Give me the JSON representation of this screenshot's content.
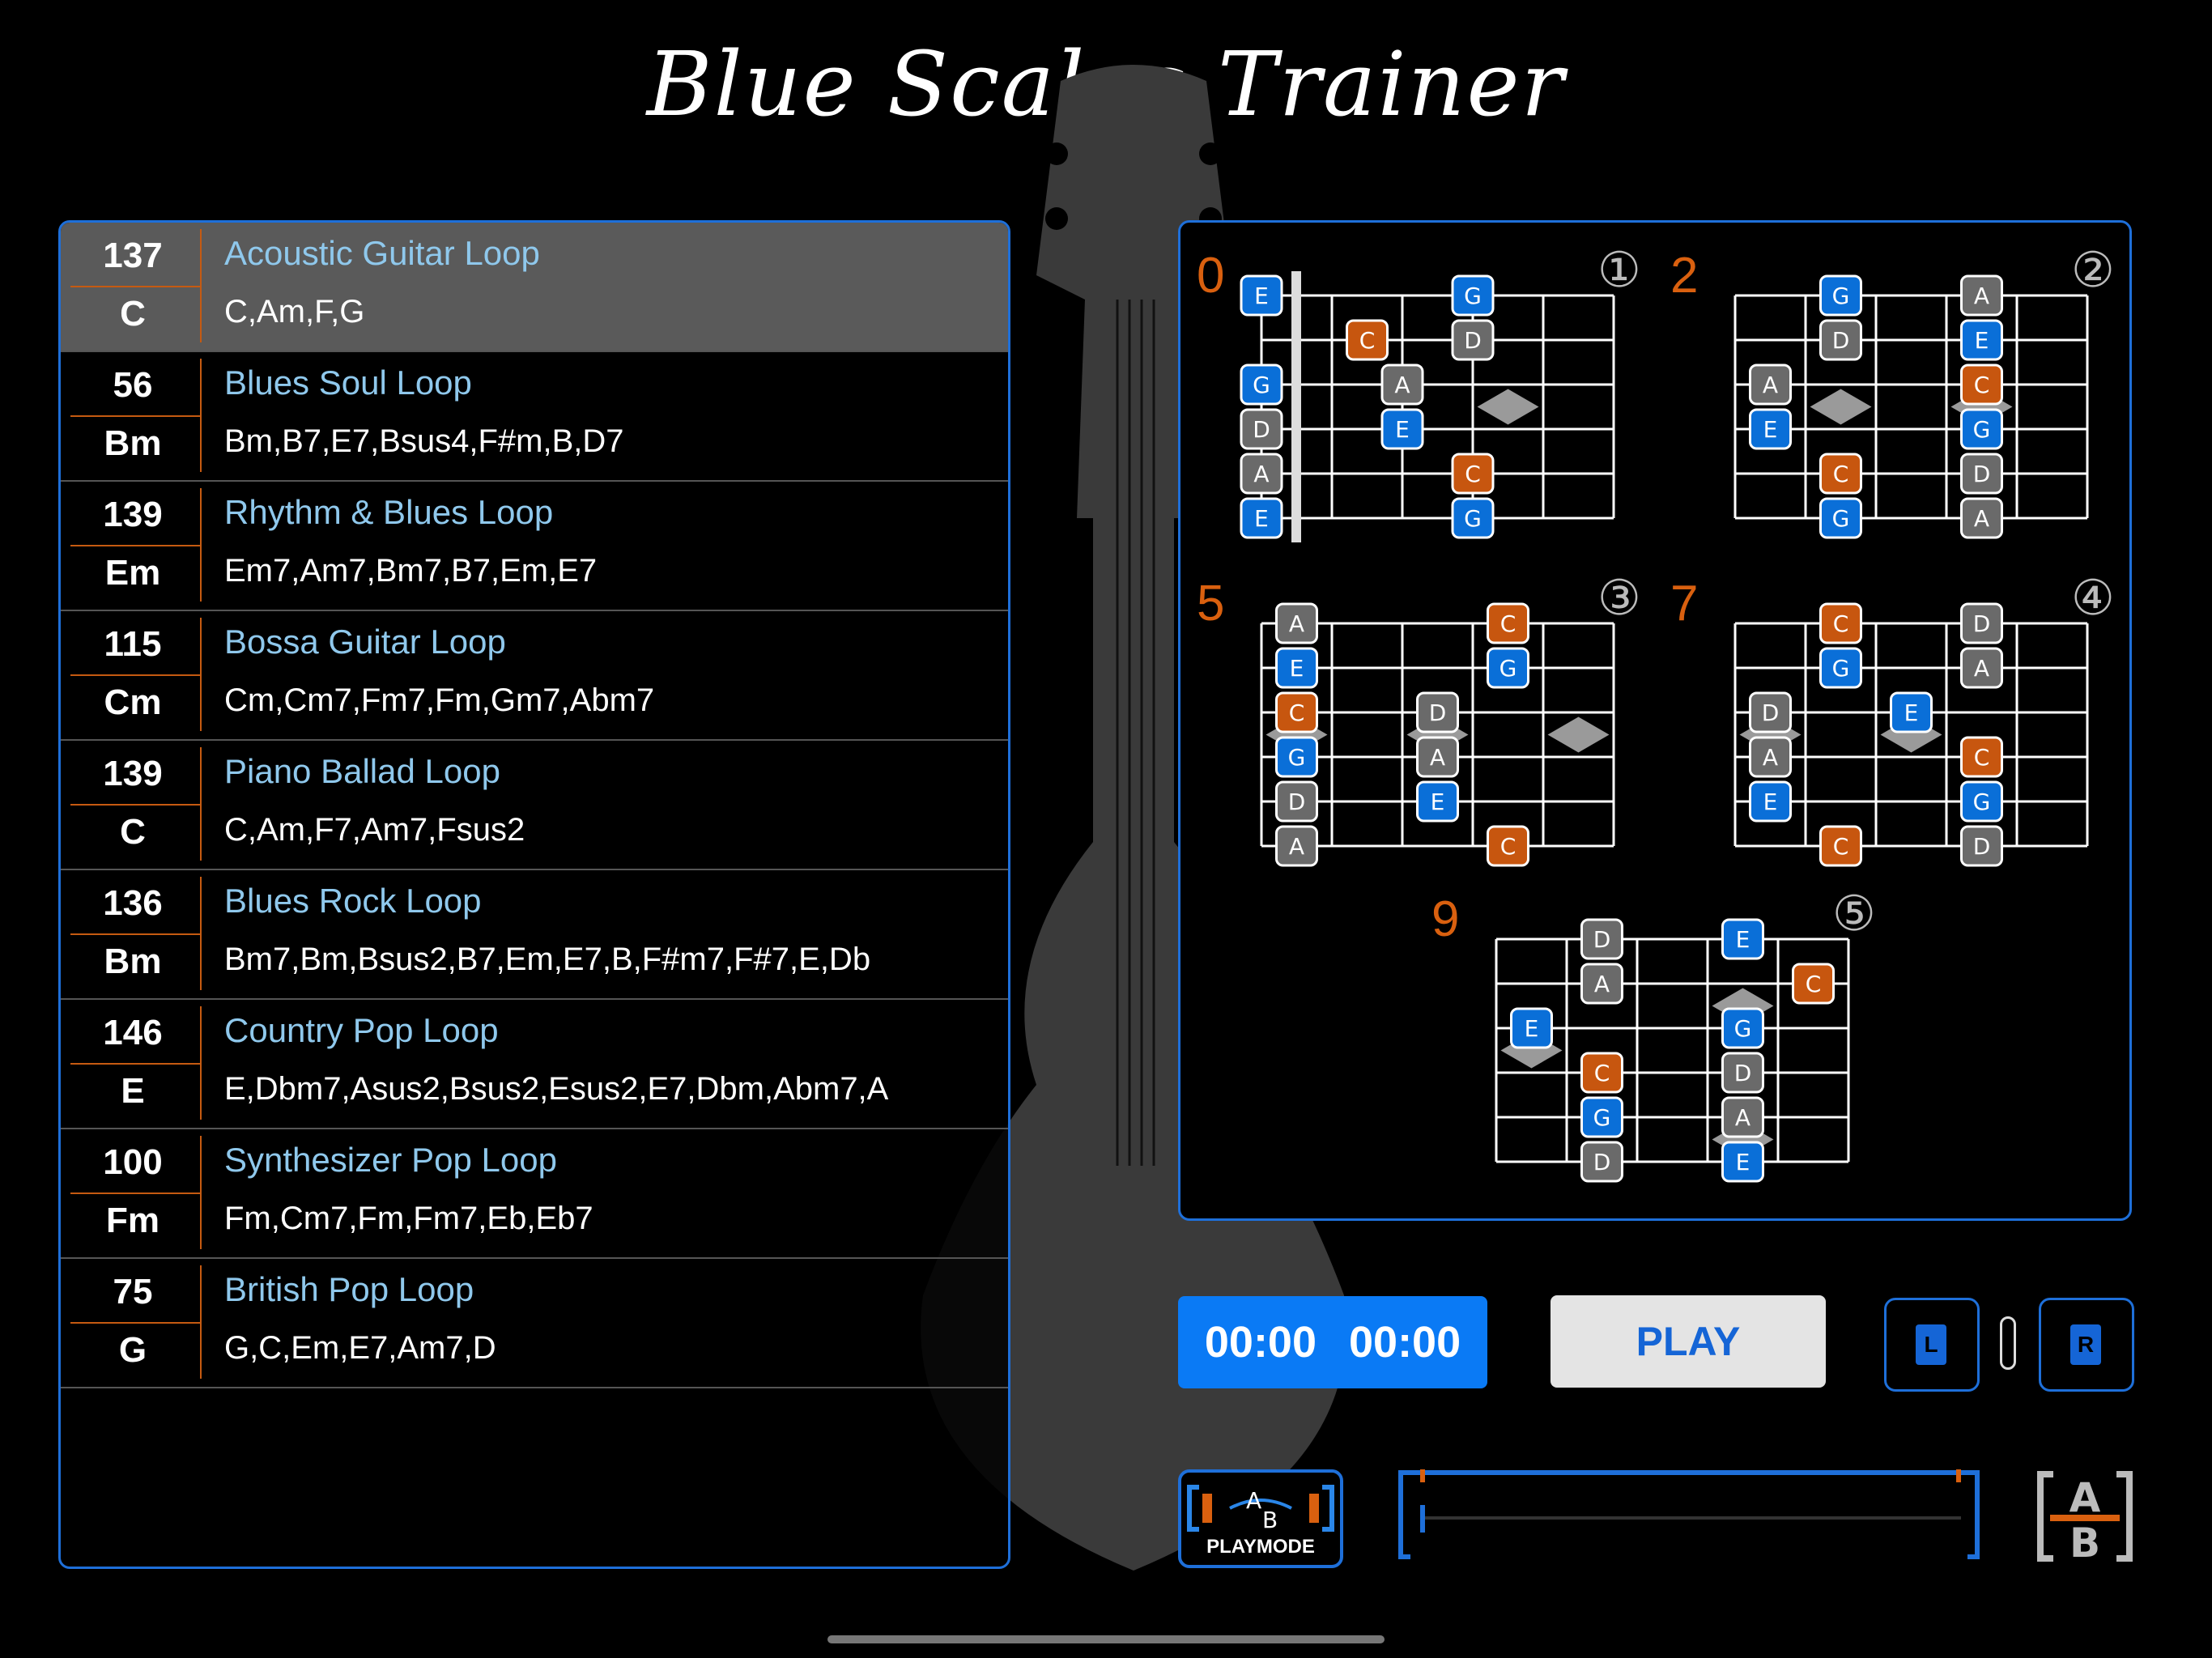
{
  "app": {
    "title": "Blue Scales Trainer"
  },
  "loops": [
    {
      "bpm": "137",
      "key": "C",
      "name": "Acoustic Guitar Loop",
      "chords": "C,Am,F,G",
      "selected": true
    },
    {
      "bpm": "56",
      "key": "Bm",
      "name": "Blues Soul Loop",
      "chords": "Bm,B7,E7,Bsus4,F#m,B,D7"
    },
    {
      "bpm": "139",
      "key": "Em",
      "name": "Rhythm & Blues Loop",
      "chords": "Em7,Am7,Bm7,B7,Em,E7"
    },
    {
      "bpm": "115",
      "key": "Cm",
      "name": "Bossa Guitar Loop",
      "chords": "Cm,Cm7,Fm7,Fm,Gm7,Abm7"
    },
    {
      "bpm": "139",
      "key": "C",
      "name": "Piano Ballad Loop",
      "chords": "C,Am,F7,Am7,Fsus2"
    },
    {
      "bpm": "136",
      "key": "Bm",
      "name": "Blues Rock Loop",
      "chords": "Bm7,Bm,Bsus2,B7,Em,E7,B,F#m7,F#7,E,Db"
    },
    {
      "bpm": "146",
      "key": "E",
      "name": "Country Pop Loop",
      "chords": "E,Dbm7,Asus2,Bsus2,Esus2,E7,Dbm,Abm7,A"
    },
    {
      "bpm": "100",
      "key": "Fm",
      "name": "Synthesizer Pop Loop",
      "chords": "Fm,Cm7,Fm,Fm7,Eb,Eb7"
    },
    {
      "bpm": "75",
      "key": "G",
      "name": "British Pop Loop",
      "chords": "G,C,Em,E7,Am7,D"
    }
  ],
  "scale_diagrams": [
    {
      "fret": "0",
      "position": "①",
      "nut": true,
      "notes": [
        {
          "s": 0,
          "f": 0,
          "n": "E",
          "c": "blue"
        },
        {
          "s": 0,
          "f": 3,
          "n": "G",
          "c": "blue"
        },
        {
          "s": 1,
          "f": 1.5,
          "n": "C",
          "c": "orange"
        },
        {
          "s": 1,
          "f": 3,
          "n": "D",
          "c": "gray"
        },
        {
          "s": 2,
          "f": 0,
          "n": "G",
          "c": "blue"
        },
        {
          "s": 2,
          "f": 2,
          "n": "A",
          "c": "gray"
        },
        {
          "s": 3,
          "f": 0,
          "n": "D",
          "c": "gray"
        },
        {
          "s": 3,
          "f": 2,
          "n": "E",
          "c": "blue"
        },
        {
          "s": 4,
          "f": 0,
          "n": "A",
          "c": "gray"
        },
        {
          "s": 4,
          "f": 3,
          "n": "C",
          "c": "orange"
        },
        {
          "s": 5,
          "f": 0,
          "n": "E",
          "c": "blue"
        },
        {
          "s": 5,
          "f": 3,
          "n": "G",
          "c": "blue"
        }
      ],
      "markers": [
        {
          "f": 3.5,
          "s": 2.5
        }
      ]
    },
    {
      "fret": "2",
      "position": "②",
      "notes": [
        {
          "s": 0,
          "f": 1.5,
          "n": "G",
          "c": "blue"
        },
        {
          "s": 0,
          "f": 3.5,
          "n": "A",
          "c": "gray"
        },
        {
          "s": 1,
          "f": 1.5,
          "n": "D",
          "c": "gray"
        },
        {
          "s": 1,
          "f": 3.5,
          "n": "E",
          "c": "blue"
        },
        {
          "s": 2,
          "f": 0.5,
          "n": "A",
          "c": "gray"
        },
        {
          "s": 2,
          "f": 3.5,
          "n": "C",
          "c": "orange"
        },
        {
          "s": 3,
          "f": 0.5,
          "n": "E",
          "c": "blue"
        },
        {
          "s": 3,
          "f": 3.5,
          "n": "G",
          "c": "blue"
        },
        {
          "s": 4,
          "f": 1.5,
          "n": "C",
          "c": "orange"
        },
        {
          "s": 4,
          "f": 3.5,
          "n": "D",
          "c": "gray"
        },
        {
          "s": 5,
          "f": 1.5,
          "n": "G",
          "c": "blue"
        },
        {
          "s": 5,
          "f": 3.5,
          "n": "A",
          "c": "gray"
        }
      ],
      "markers": [
        {
          "f": 1.5,
          "s": 2.5
        },
        {
          "f": 3.5,
          "s": 2.5
        }
      ]
    },
    {
      "fret": "5",
      "position": "③",
      "notes": [
        {
          "s": 0,
          "f": 0.5,
          "n": "A",
          "c": "gray"
        },
        {
          "s": 0,
          "f": 3.5,
          "n": "C",
          "c": "orange"
        },
        {
          "s": 1,
          "f": 0.5,
          "n": "E",
          "c": "blue"
        },
        {
          "s": 1,
          "f": 3.5,
          "n": "G",
          "c": "blue"
        },
        {
          "s": 2,
          "f": 0.5,
          "n": "C",
          "c": "orange"
        },
        {
          "s": 2,
          "f": 2.5,
          "n": "D",
          "c": "gray"
        },
        {
          "s": 3,
          "f": 0.5,
          "n": "G",
          "c": "blue"
        },
        {
          "s": 3,
          "f": 2.5,
          "n": "A",
          "c": "gray"
        },
        {
          "s": 4,
          "f": 0.5,
          "n": "D",
          "c": "gray"
        },
        {
          "s": 4,
          "f": 2.5,
          "n": "E",
          "c": "blue"
        },
        {
          "s": 5,
          "f": 0.5,
          "n": "A",
          "c": "gray"
        },
        {
          "s": 5,
          "f": 3.5,
          "n": "C",
          "c": "orange"
        }
      ],
      "markers": [
        {
          "f": 0.5,
          "s": 2.5
        },
        {
          "f": 2.5,
          "s": 2.5
        },
        {
          "f": 4.5,
          "s": 2.5
        }
      ]
    },
    {
      "fret": "7",
      "position": "④",
      "notes": [
        {
          "s": 0,
          "f": 1.5,
          "n": "C",
          "c": "orange"
        },
        {
          "s": 0,
          "f": 3.5,
          "n": "D",
          "c": "gray"
        },
        {
          "s": 1,
          "f": 1.5,
          "n": "G",
          "c": "blue"
        },
        {
          "s": 1,
          "f": 3.5,
          "n": "A",
          "c": "gray"
        },
        {
          "s": 2,
          "f": 0.5,
          "n": "D",
          "c": "gray"
        },
        {
          "s": 2,
          "f": 2.5,
          "n": "E",
          "c": "blue"
        },
        {
          "s": 3,
          "f": 0.5,
          "n": "A",
          "c": "gray"
        },
        {
          "s": 3,
          "f": 3.5,
          "n": "C",
          "c": "orange"
        },
        {
          "s": 4,
          "f": 0.5,
          "n": "E",
          "c": "blue"
        },
        {
          "s": 4,
          "f": 3.5,
          "n": "G",
          "c": "blue"
        },
        {
          "s": 5,
          "f": 1.5,
          "n": "C",
          "c": "orange"
        },
        {
          "s": 5,
          "f": 3.5,
          "n": "D",
          "c": "gray"
        }
      ],
      "markers": [
        {
          "f": 0.5,
          "s": 2.5
        },
        {
          "f": 2.5,
          "s": 2.5
        }
      ]
    },
    {
      "fret": "9",
      "position": "⑤",
      "notes": [
        {
          "s": 0,
          "f": 1.5,
          "n": "D",
          "c": "gray"
        },
        {
          "s": 0,
          "f": 3.5,
          "n": "E",
          "c": "blue"
        },
        {
          "s": 1,
          "f": 1.5,
          "n": "A",
          "c": "gray"
        },
        {
          "s": 1,
          "f": 4.5,
          "n": "C",
          "c": "orange"
        },
        {
          "s": 2,
          "f": 0.5,
          "n": "E",
          "c": "blue"
        },
        {
          "s": 2,
          "f": 3.5,
          "n": "G",
          "c": "blue"
        },
        {
          "s": 3,
          "f": 1.5,
          "n": "C",
          "c": "orange"
        },
        {
          "s": 3,
          "f": 3.5,
          "n": "D",
          "c": "gray"
        },
        {
          "s": 4,
          "f": 1.5,
          "n": "G",
          "c": "blue"
        },
        {
          "s": 4,
          "f": 3.5,
          "n": "A",
          "c": "gray"
        },
        {
          "s": 5,
          "f": 1.5,
          "n": "D",
          "c": "gray"
        },
        {
          "s": 5,
          "f": 3.5,
          "n": "E",
          "c": "blue"
        }
      ],
      "markers": [
        {
          "f": 0.5,
          "s": 2.5
        },
        {
          "f": 3.5,
          "s": 1.5
        },
        {
          "f": 3.5,
          "s": 4.5
        }
      ]
    }
  ],
  "controls": {
    "time_elapsed": "00:00",
    "time_total": "00:00",
    "play_label": "PLAY",
    "left_label": "L",
    "right_label": "R",
    "playmode_label": "PLAYMODE",
    "playmode_a": "A",
    "playmode_b": "B",
    "ab_a": "A",
    "ab_b": "B"
  },
  "colors": {
    "accent": "#1e6fd9",
    "blue_note": "#0a6fd8",
    "orange_note": "#c7560f",
    "gray_note": "#6a6a6a",
    "fret_number": "#d9600f"
  },
  "icons": {
    "playmode": "ab-loop-playmode-icon",
    "ab_toggle": "ab-toggle-icon",
    "background": "guitar-silhouette"
  }
}
